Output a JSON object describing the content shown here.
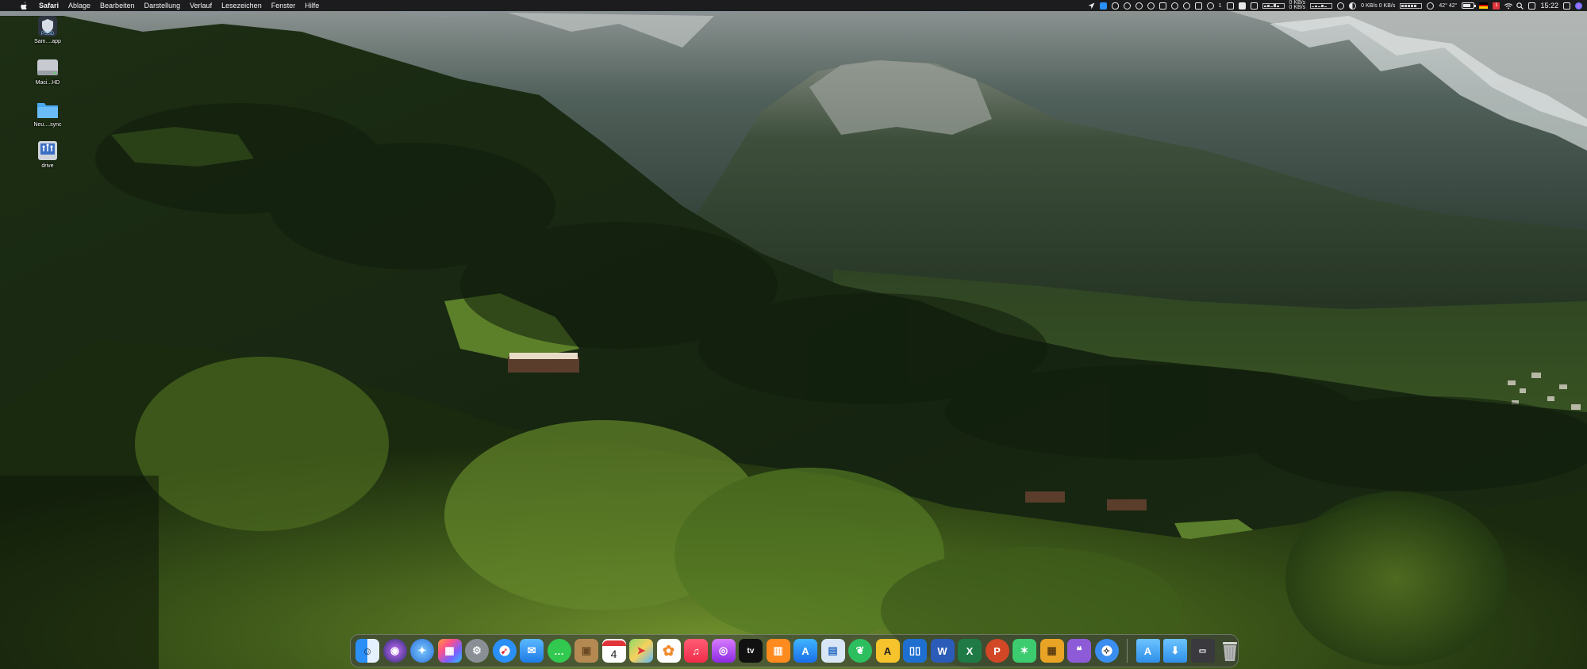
{
  "menubar": {
    "app_name": "Safari",
    "items": [
      "Ablage",
      "Bearbeiten",
      "Darstellung",
      "Verlauf",
      "Lesezeichen",
      "Fenster",
      "Hilfe"
    ],
    "net_up": "0 KB/s",
    "net_down": "0 KB/s",
    "cpu_stats": "0 KB/s 0 KB/s",
    "disk_stats": "42° 42°",
    "bluetooth_count": "1",
    "calendar_badge": "1",
    "clock": "15:22"
  },
  "desktop": {
    "icons": [
      {
        "label": "Sam....app",
        "icon": "shield-app-icon"
      },
      {
        "label": "Maci...HD",
        "icon": "hard-drive-icon"
      },
      {
        "label": "Neu....sync",
        "icon": "folder-icon"
      },
      {
        "label": "drive",
        "icon": "network-drive-icon"
      }
    ]
  },
  "dock": {
    "calendar_day": "4",
    "tv_label": "tv",
    "word_letter": "W",
    "excel_letter": "X",
    "ppt_letter": "P"
  },
  "colors": {
    "menubar_bg": "#121214",
    "finder_blue": "#2a8ff7",
    "calendar_red": "#e0343a",
    "word_blue": "#2b5cb8",
    "excel_green": "#1f7a45",
    "ppt_orange": "#d24726"
  }
}
